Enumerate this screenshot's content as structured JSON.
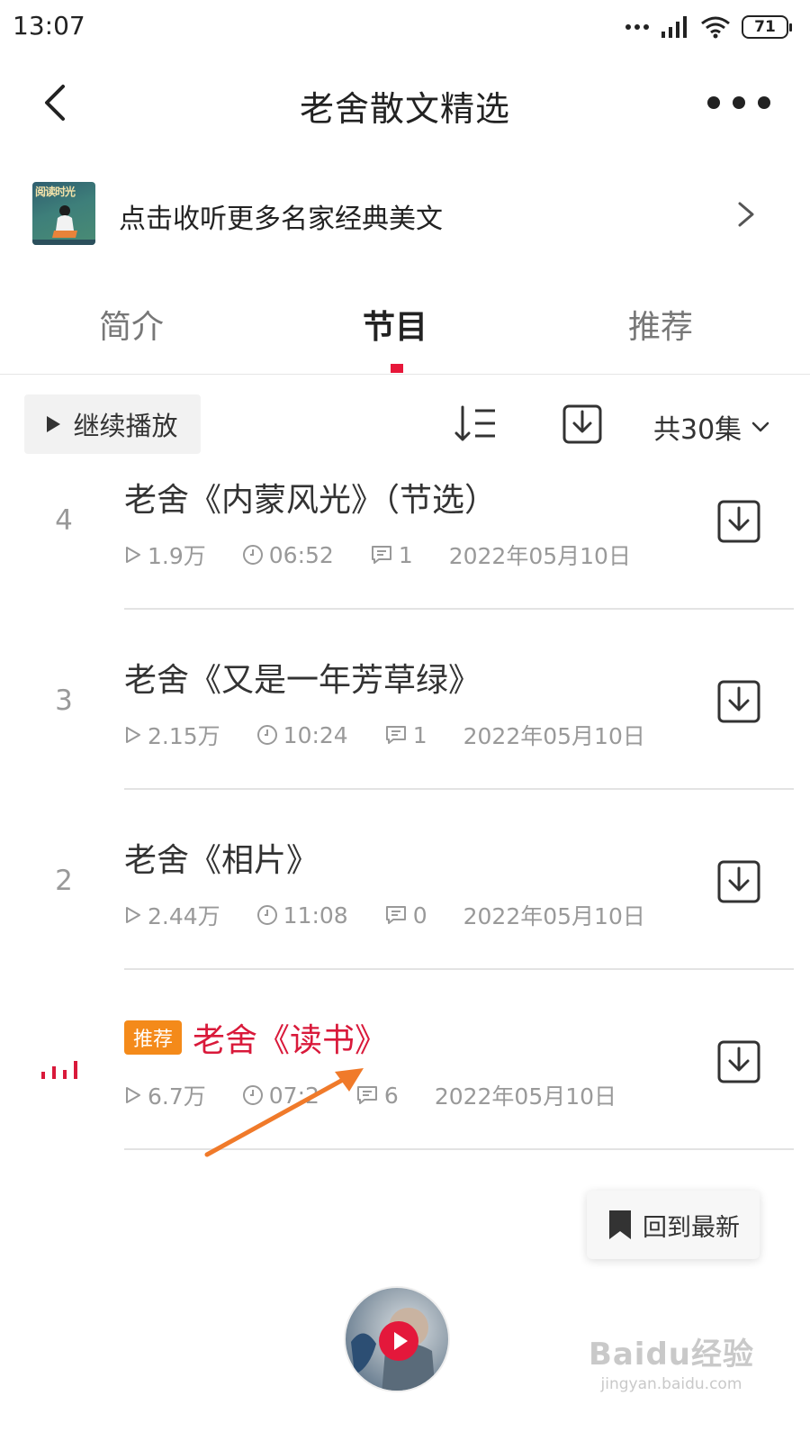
{
  "status_bar": {
    "time": "13:07",
    "battery": "71"
  },
  "header": {
    "title": "老舍散文精选"
  },
  "banner": {
    "text": "点击收听更多名家经典美文",
    "thumb_text": "阅读时光"
  },
  "tabs": [
    {
      "label": "简介"
    },
    {
      "label": "节目",
      "active": true
    },
    {
      "label": "推荐"
    }
  ],
  "toolbar": {
    "continue_label": "继续播放",
    "count_label": "共30集"
  },
  "episodes": [
    {
      "num": "4",
      "title": "老舍《内蒙风光》（节选）",
      "plays": "1.9万",
      "duration": "06:52",
      "comments": "1",
      "date": "2022年05月10日"
    },
    {
      "num": "3",
      "title": "老舍《又是一年芳草绿》",
      "plays": "2.15万",
      "duration": "10:24",
      "comments": "1",
      "date": "2022年05月10日"
    },
    {
      "num": "2",
      "title": "老舍《相片》",
      "plays": "2.44万",
      "duration": "11:08",
      "comments": "0",
      "date": "2022年05月10日"
    },
    {
      "num": "",
      "badge": "推荐",
      "title": "老舍《读书》",
      "plays": "6.7万",
      "duration": "07:2",
      "comments": "6",
      "date": "2022年05月10日",
      "playing": true
    }
  ],
  "back_to_latest": {
    "label": "回到最新"
  },
  "watermark": {
    "main": "Baidu经验",
    "sub": "jingyan.baidu.com"
  },
  "colors": {
    "accent_red": "#e7173a",
    "badge_orange": "#f48a1a",
    "annotation_arrow": "#f07a2a"
  },
  "icons": [
    "back-icon",
    "more-icon",
    "chevron-right-icon",
    "play-icon",
    "sort-icon",
    "download-icon",
    "chevron-down-icon",
    "play-count-icon",
    "clock-icon",
    "comment-icon",
    "bookmark-icon",
    "signal-icon",
    "wifi-icon",
    "battery-icon"
  ]
}
